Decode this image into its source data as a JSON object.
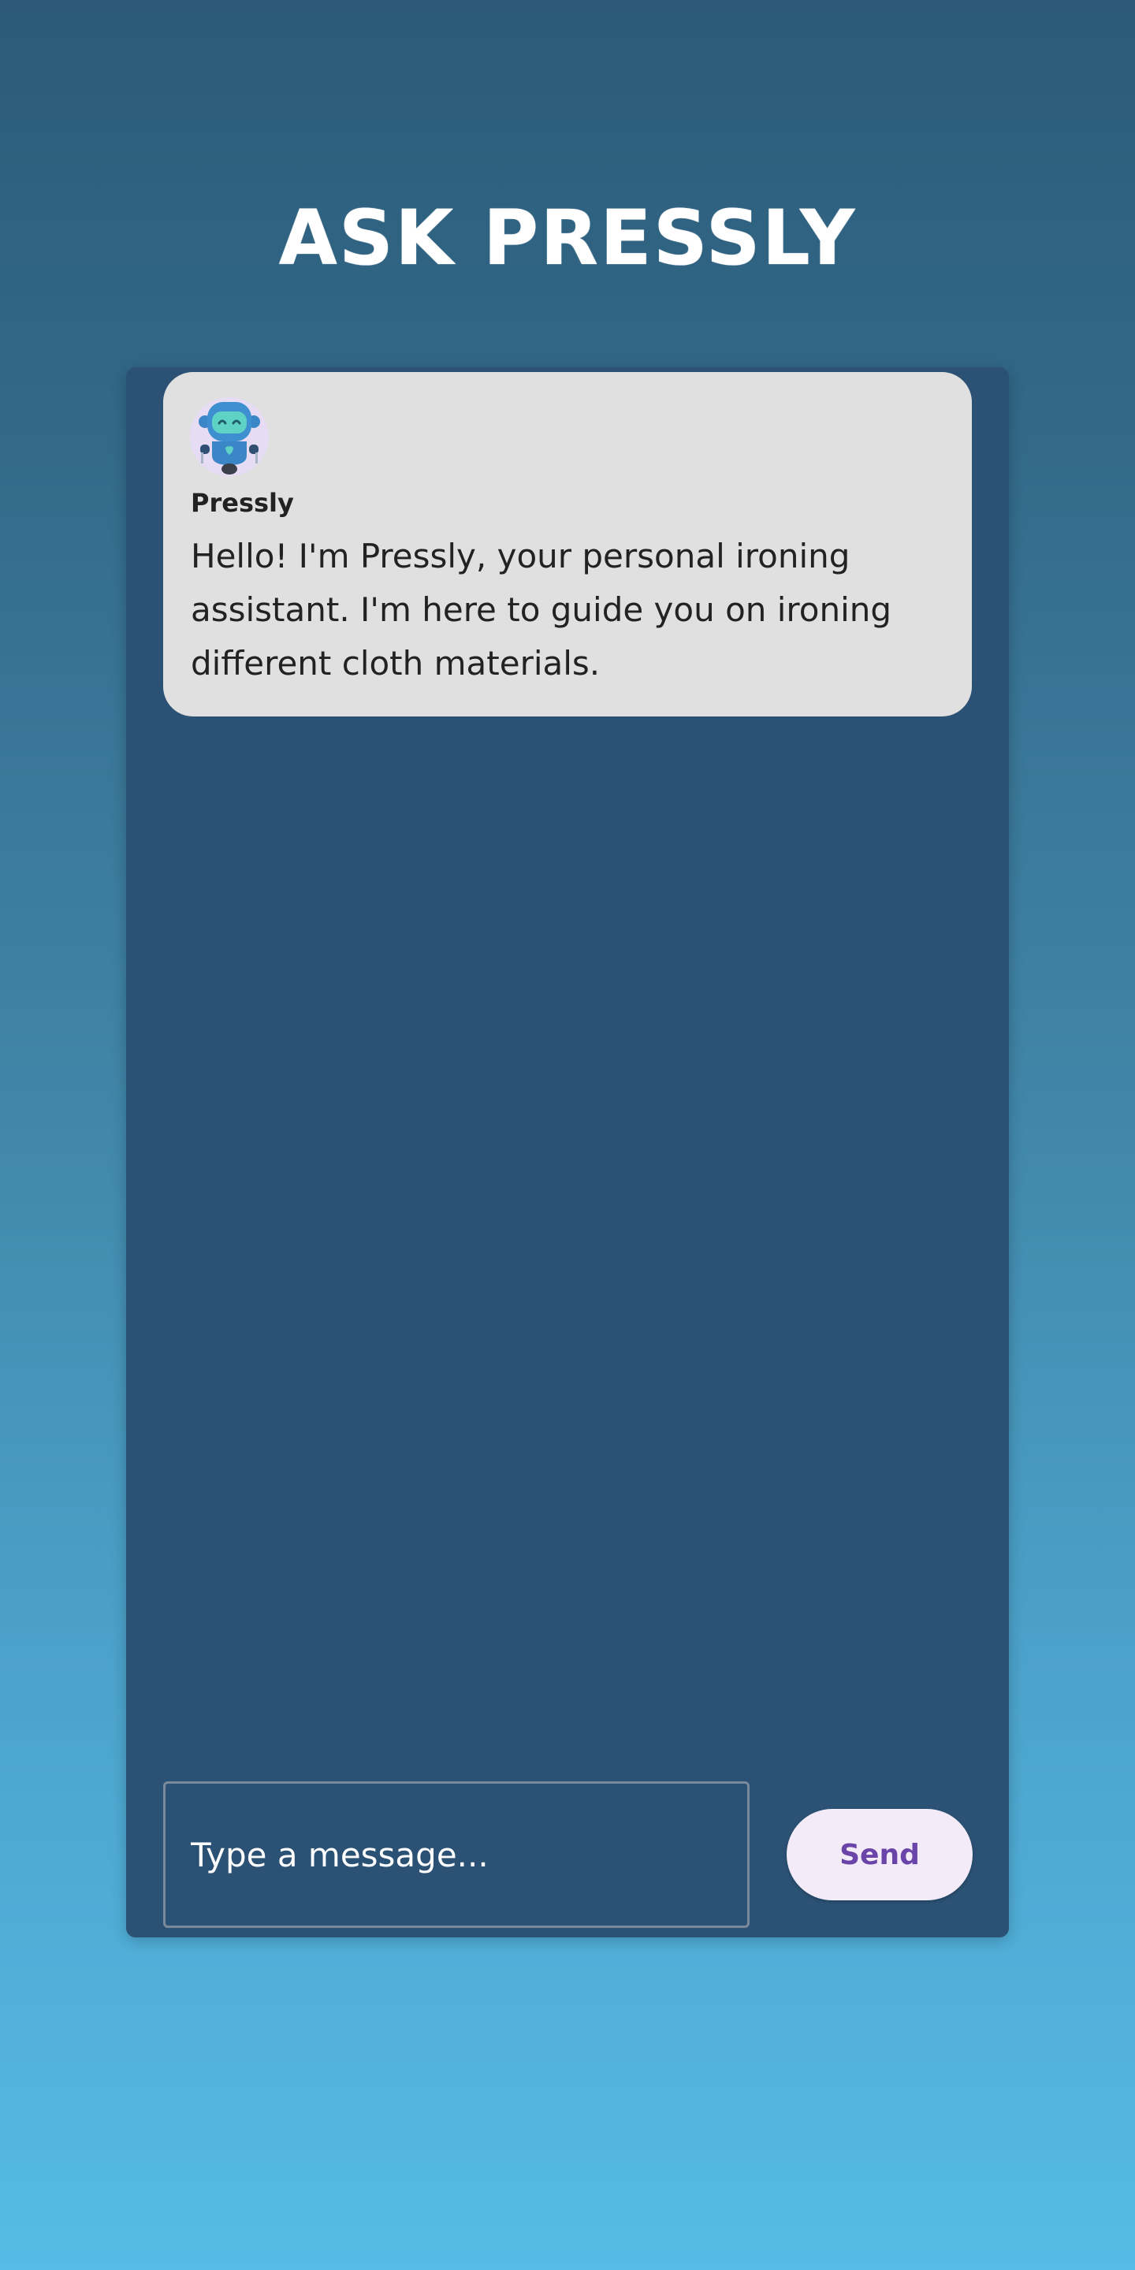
{
  "page": {
    "title": "ASK PRESSLY"
  },
  "chat": {
    "messages": [
      {
        "sender": "Pressly",
        "avatar_icon": "robot-icon",
        "text": "Hello! I'm Pressly, your personal ironing assistant. I'm here to guide you on ironing different cloth materials."
      }
    ]
  },
  "composer": {
    "placeholder": "Type a message...",
    "value": "",
    "send_label": "Send"
  },
  "colors": {
    "background_top": "#2c5a78",
    "background_bottom": "#56bbe6",
    "panel": "#2b5174",
    "bubble": "#e0e0e0",
    "send_button_bg": "#f3ecf8",
    "send_button_text": "#6a44a8"
  }
}
